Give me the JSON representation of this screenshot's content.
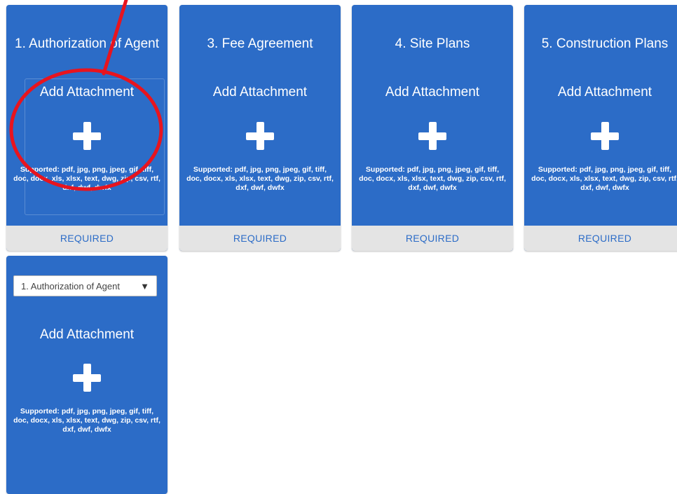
{
  "cards": [
    {
      "title": "1. Authorization of Agent",
      "add_label": "Add Attachment",
      "supported": "Supported: pdf, jpg, png, jpeg, gif, tiff, doc, docx, xls, xlsx, text, dwg, zip, csv, rtf, dxf, dwf, dwfx",
      "status": "REQUIRED"
    },
    {
      "title": "3. Fee Agreement",
      "add_label": "Add Attachment",
      "supported": "Supported: pdf, jpg, png, jpeg, gif, tiff, doc, docx, xls, xlsx, text, dwg, zip, csv, rtf, dxf, dwf, dwfx",
      "status": "REQUIRED"
    },
    {
      "title": "4. Site Plans",
      "add_label": "Add Attachment",
      "supported": "Supported: pdf, jpg, png, jpeg, gif, tiff, doc, docx, xls, xlsx, text, dwg, zip, csv, rtf, dxf, dwf, dwfx",
      "status": "REQUIRED"
    },
    {
      "title": "5. Construction Plans",
      "add_label": "Add Attachment",
      "supported": "Supported: pdf, jpg, png, jpeg, gif, tiff, doc, docx, xls, xlsx, text, dwg, zip, csv, rtf, dxf, dwf, dwfx",
      "status": "REQUIRED"
    }
  ],
  "extra_card": {
    "select_value": "1. Authorization of Agent",
    "select_arrow": "▼",
    "add_label": "Add Attachment",
    "supported": "Supported: pdf, jpg, png, jpeg, gif, tiff, doc, docx, xls, xlsx, text, dwg, zip, csv, rtf, dxf, dwf, dwfx"
  },
  "colors": {
    "card_blue": "#2c6cc7",
    "footer_gray": "#e4e4e4",
    "annotation_red": "#e8141e"
  },
  "icons": {
    "add": "plus-icon",
    "dropdown": "triangle-down-icon"
  }
}
